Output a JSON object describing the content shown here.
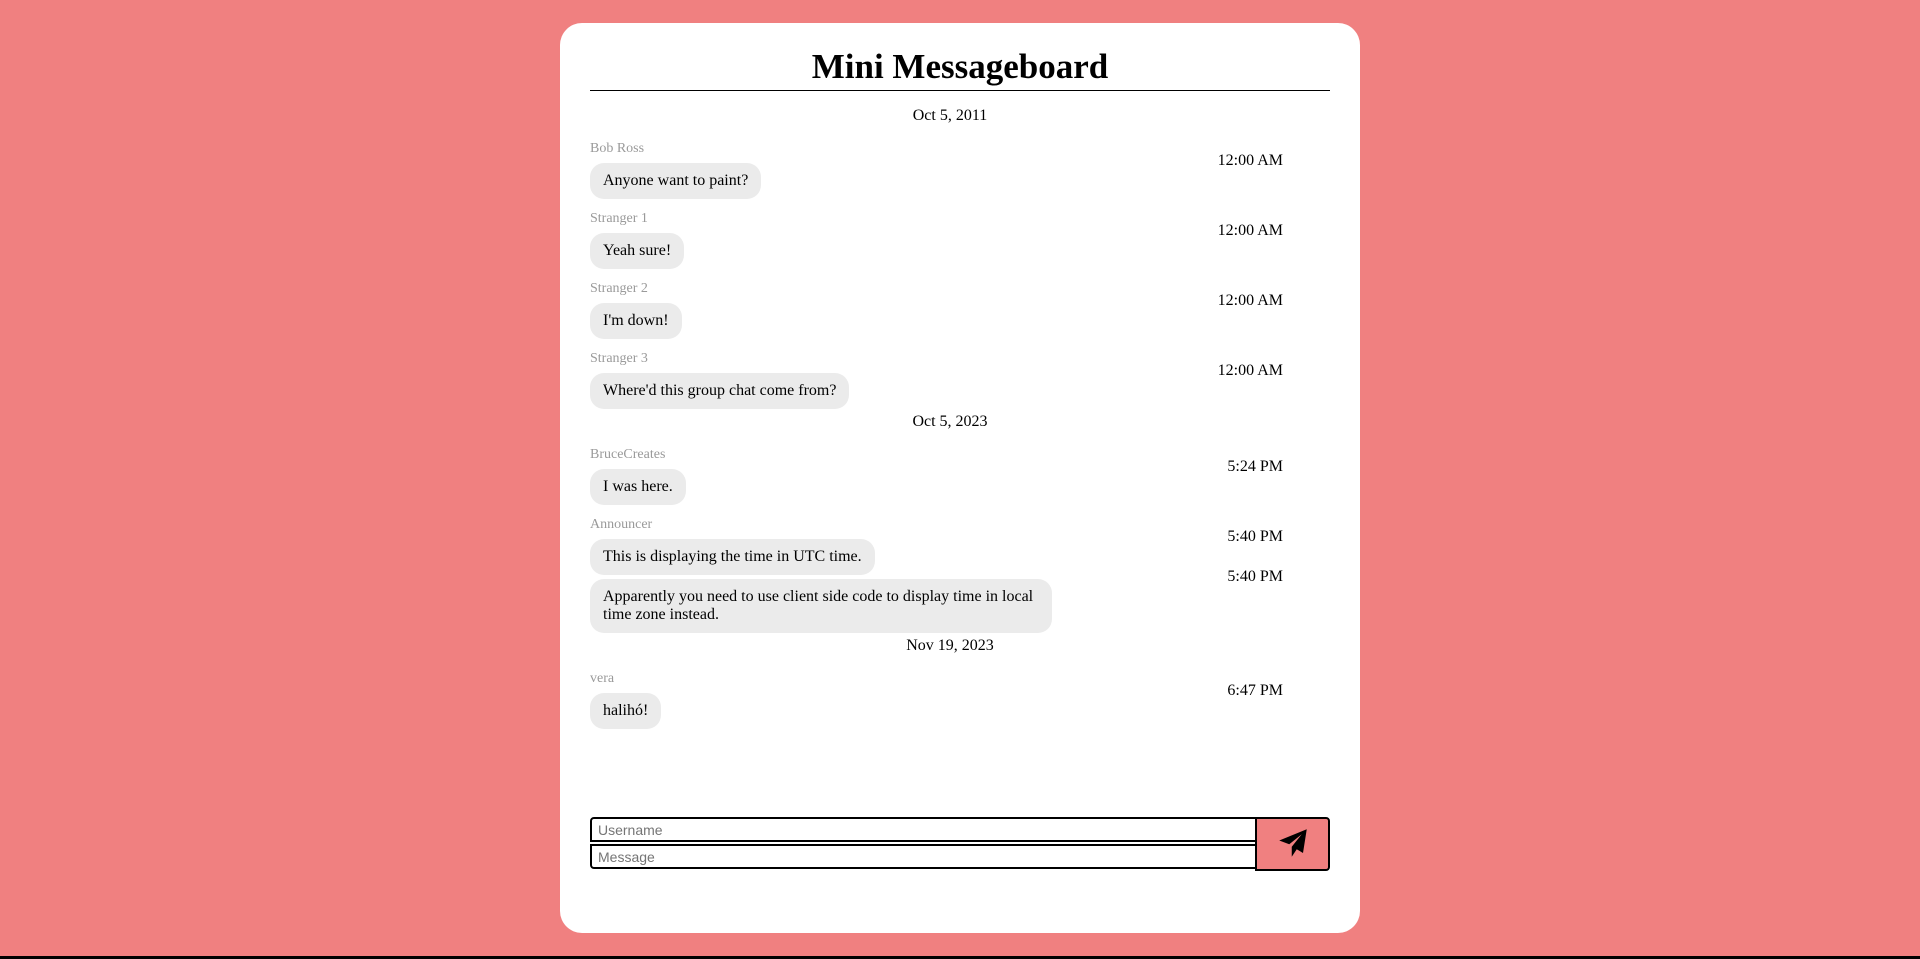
{
  "app": {
    "title": "Mini Messageboard"
  },
  "colors": {
    "background": "#f08080",
    "bubble": "#ebebeb",
    "author": "#9a9a9a"
  },
  "days": [
    {
      "date": "Oct 5, 2011",
      "groups": [
        {
          "author": "Bob Ross",
          "messages": [
            {
              "text": "Anyone want to paint?",
              "time": "12:00 AM"
            }
          ]
        },
        {
          "author": "Stranger 1",
          "messages": [
            {
              "text": "Yeah sure!",
              "time": "12:00 AM"
            }
          ]
        },
        {
          "author": "Stranger 2",
          "messages": [
            {
              "text": "I'm down!",
              "time": "12:00 AM"
            }
          ]
        },
        {
          "author": "Stranger 3",
          "messages": [
            {
              "text": "Where'd this group chat come from?",
              "time": "12:00 AM"
            }
          ]
        }
      ]
    },
    {
      "date": "Oct 5, 2023",
      "groups": [
        {
          "author": "BruceCreates",
          "messages": [
            {
              "text": "I was here.",
              "time": "5:24 PM"
            }
          ]
        },
        {
          "author": "Announcer",
          "messages": [
            {
              "text": "This is displaying the time in UTC time.",
              "time": "5:40 PM"
            },
            {
              "text": "Apparently you need to use client side code to display time in local time zone instead.",
              "time": "5:40 PM"
            }
          ]
        }
      ]
    },
    {
      "date": "Nov 19, 2023",
      "groups": [
        {
          "author": "vera",
          "messages": [
            {
              "text": "halihó!",
              "time": "6:47 PM"
            }
          ]
        }
      ]
    }
  ],
  "form": {
    "username_placeholder": "Username",
    "message_placeholder": "Message",
    "send_icon": "paper-plane-icon"
  },
  "scrollbar": {
    "up_arrow": "▲",
    "down_arrow": "▼"
  }
}
